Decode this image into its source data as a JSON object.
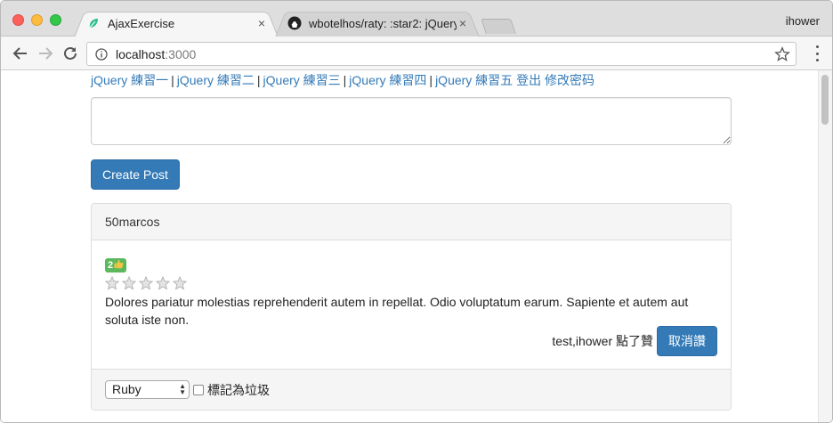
{
  "browser": {
    "tabs": [
      {
        "title": "AjaxExercise",
        "close": "×",
        "icon": "leaf-icon"
      },
      {
        "title": "wbotelhos/raty: :star2: jQuery",
        "close": "×",
        "icon": "github-icon"
      }
    ],
    "profile_name": "ihower",
    "url_host": "localhost",
    "url_port": ":3000"
  },
  "nav": {
    "links": [
      "jQuery 練習一",
      "jQuery 練習二",
      "jQuery 練習三",
      "jQuery 練習四",
      "jQuery 練習五"
    ],
    "separator": "|",
    "logout": "登出",
    "change_password": "修改密码"
  },
  "form": {
    "textarea_value": "",
    "create_button": "Create Post"
  },
  "post": {
    "author": "50marcos",
    "like_count": "2",
    "rating": {
      "value": 0,
      "max": 5
    },
    "content": "Dolores pariatur molestias reprehenderit autem in repellat. Odio voluptatum earum. Sapiente et autem aut soluta iste non.",
    "liked_by": "test,ihower 點了贊",
    "unlike_button": "取消讚",
    "category_selected": "Ruby",
    "spam_label": "標記為垃圾"
  },
  "colors": {
    "link": "#337ab7",
    "primary": "#337ab7",
    "badge": "#5cb85c"
  }
}
